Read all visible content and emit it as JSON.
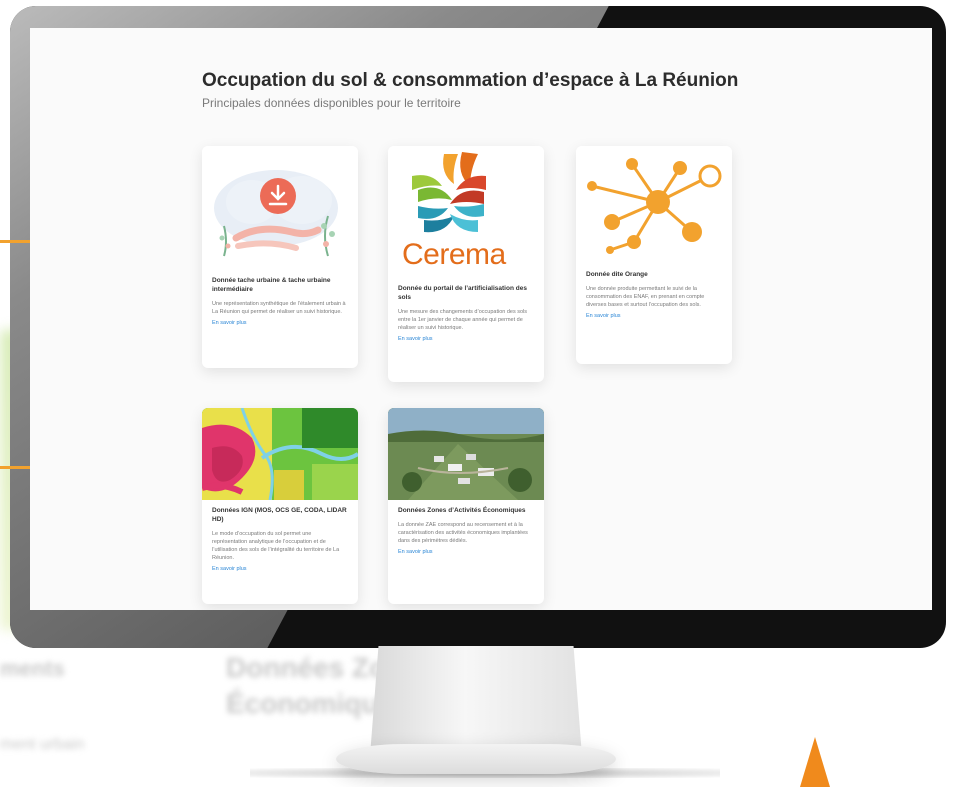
{
  "page": {
    "title": "Occupation du sol & consommation d’espace à La Réunion",
    "subtitle": "Principales données disponibles pour le territoire"
  },
  "cards": [
    {
      "title": "Donnée tache urbaine & tache urbaine intermédiaire",
      "description": "Une représentation synthétique de l’étalement urbain à La Réunion qui permet de réaliser un suivi historique.",
      "link": "En savoir plus",
      "icon": "download-cloud-icon"
    },
    {
      "title": "Donnée du portail de l’artificialisation des sols",
      "description": "Une mesure des changements d’occupation des sols entre la 1er janvier de chaque année qui permet de réaliser un suivi historique.",
      "link": "En savoir plus",
      "logo_text": "Cerema",
      "icon": "cerema-logo"
    },
    {
      "title": "Donnée dite Orange",
      "description": "Une donnée produite permettant le suivi de la consommation des ENAF, en prenant en compte diverses bases et surtout l’occupation des sols.",
      "link": "En savoir plus",
      "icon": "network-nodes-icon"
    },
    {
      "title": "Données IGN (MOS, OCS GE, CODA, LIDAR HD)",
      "description": "Le mode d’occupation du sol permet une représentation analytique de l’occupation et de l’utilisation des sols de l’intégralité du territoire de La Réunion.",
      "link": "En savoir plus",
      "icon": "land-use-map-image"
    },
    {
      "title": "Données Zones d’Activités Économiques",
      "description": "La donnée ZAE correspond au recensement et à la caractérisation des activités économiques implantées dans des périmètres dédiés.",
      "link": "En savoir plus",
      "icon": "aerial-photo-image"
    }
  ],
  "background": {
    "blurred_text_1": "Données Zones",
    "blurred_text_2": "Économiques",
    "blurred_text_3": "ments",
    "blurred_text_4": "ment urbain"
  },
  "colors": {
    "accent": "#f2a22e",
    "link": "#2a86d6",
    "cerema_orange": "#e36d1b",
    "title": "#2c2c2c"
  }
}
